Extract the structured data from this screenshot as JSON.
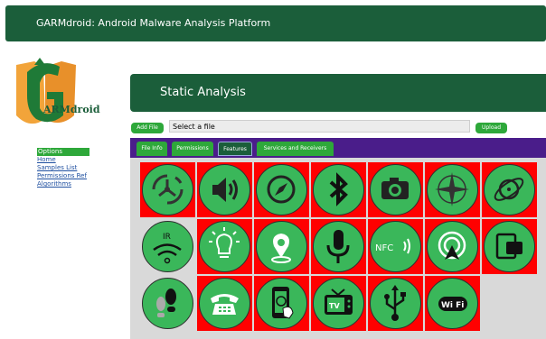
{
  "header": {
    "title": "GARMdroid: Android Malware Analysis Platform"
  },
  "logo": {
    "text": "ARMdroid"
  },
  "sidebar": {
    "items": [
      {
        "label": "Options",
        "active": true
      },
      {
        "label": "Home"
      },
      {
        "label": "Samples List"
      },
      {
        "label": "Permissions Ref"
      },
      {
        "label": "Algorithms"
      }
    ]
  },
  "main": {
    "title": "Static Analysis",
    "add_file_label": "Add File",
    "file_placeholder": "Select a file",
    "upload_label": "Upload",
    "tabs": [
      {
        "label": "File Info"
      },
      {
        "label": "Permissions"
      },
      {
        "label": "Features",
        "active": true
      },
      {
        "label": "Services and Receivers"
      }
    ],
    "features": [
      {
        "icon": "gyroscope-icon",
        "bg": "red"
      },
      {
        "icon": "speaker-icon",
        "bg": "red"
      },
      {
        "icon": "compass-icon",
        "bg": "red"
      },
      {
        "icon": "bluetooth-icon",
        "bg": "red"
      },
      {
        "icon": "camera-icon",
        "bg": "red"
      },
      {
        "icon": "wind-rose-icon",
        "bg": "red"
      },
      {
        "icon": "orbit-icon",
        "bg": "red"
      },
      {
        "icon": "ir-icon",
        "label": "IR",
        "bg": "none"
      },
      {
        "icon": "light-bulb-icon",
        "bg": "red"
      },
      {
        "icon": "location-pin-icon",
        "bg": "red"
      },
      {
        "icon": "microphone-icon",
        "bg": "red"
      },
      {
        "icon": "nfc-icon",
        "label": "NFC",
        "bg": "red"
      },
      {
        "icon": "hotspot-icon",
        "bg": "red"
      },
      {
        "icon": "screen-rotate-icon",
        "bg": "red"
      },
      {
        "icon": "footsteps-icon",
        "bg": "none"
      },
      {
        "icon": "telephone-icon",
        "bg": "red"
      },
      {
        "icon": "touchscreen-icon",
        "bg": "red"
      },
      {
        "icon": "tv-icon",
        "label": "TV",
        "bg": "red"
      },
      {
        "icon": "usb-icon",
        "bg": "red"
      },
      {
        "icon": "wifi-icon",
        "label": "Wi Fi",
        "bg": "red"
      }
    ]
  },
  "colors": {
    "header_green": "#1b5e3a",
    "button_green": "#2ea83a",
    "tab_bar": "#4a1d8a",
    "tile_red": "#ff0000",
    "icon_green": "#3ab75a"
  }
}
